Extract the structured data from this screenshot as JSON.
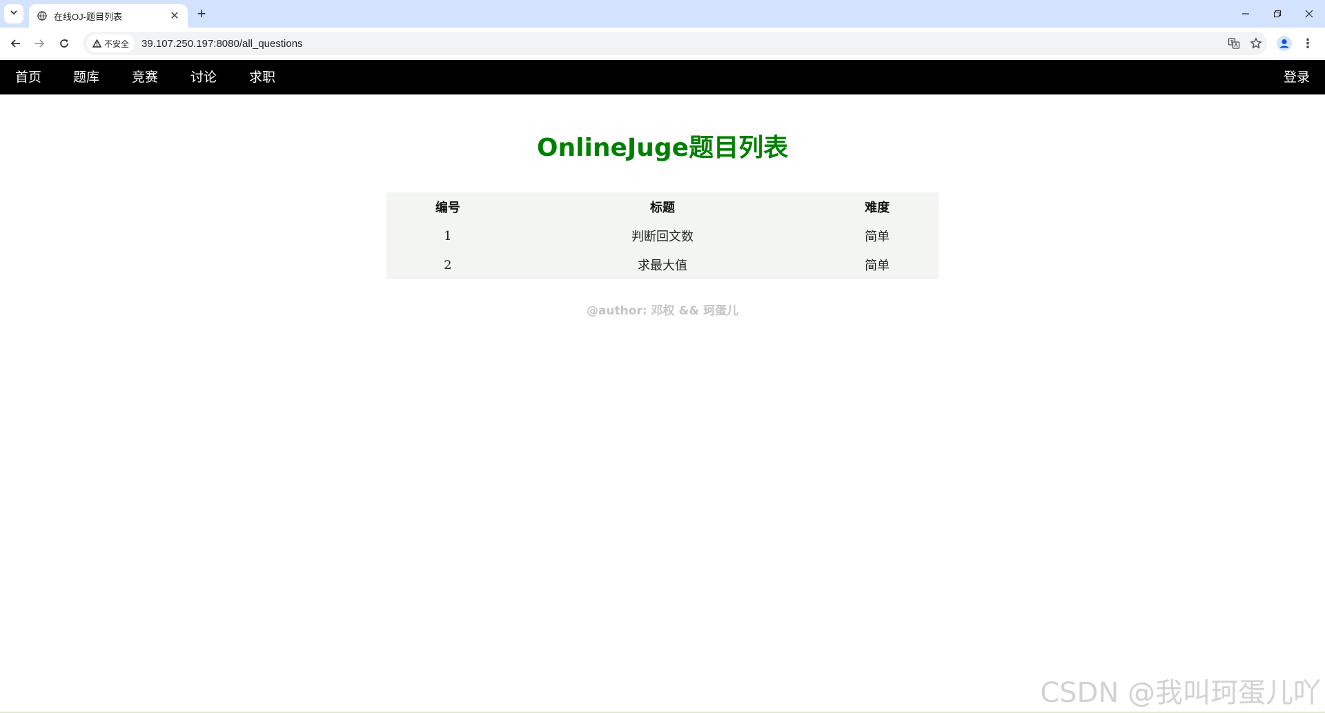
{
  "browser": {
    "tab_title": "在线OJ-题目列表",
    "security_label": "不安全",
    "url": "39.107.250.197:8080/all_questions"
  },
  "site_nav": {
    "items": [
      "首页",
      "题库",
      "竞赛",
      "讨论",
      "求职"
    ],
    "login": "登录"
  },
  "page_title": "OnlineJuge题目列表",
  "table": {
    "headers": [
      "编号",
      "标题",
      "难度"
    ],
    "rows": [
      [
        "1",
        "判断回文数",
        "简单"
      ],
      [
        "2",
        "求最大值",
        "简单"
      ]
    ]
  },
  "author": "@author: 邓权 && 珂蛋儿",
  "watermark": "CSDN @我叫珂蛋儿吖",
  "colors": {
    "title": "#008000",
    "nav_bg": "#000000",
    "table_bg": "#f3f5f3",
    "author": "#c4c4c4"
  }
}
